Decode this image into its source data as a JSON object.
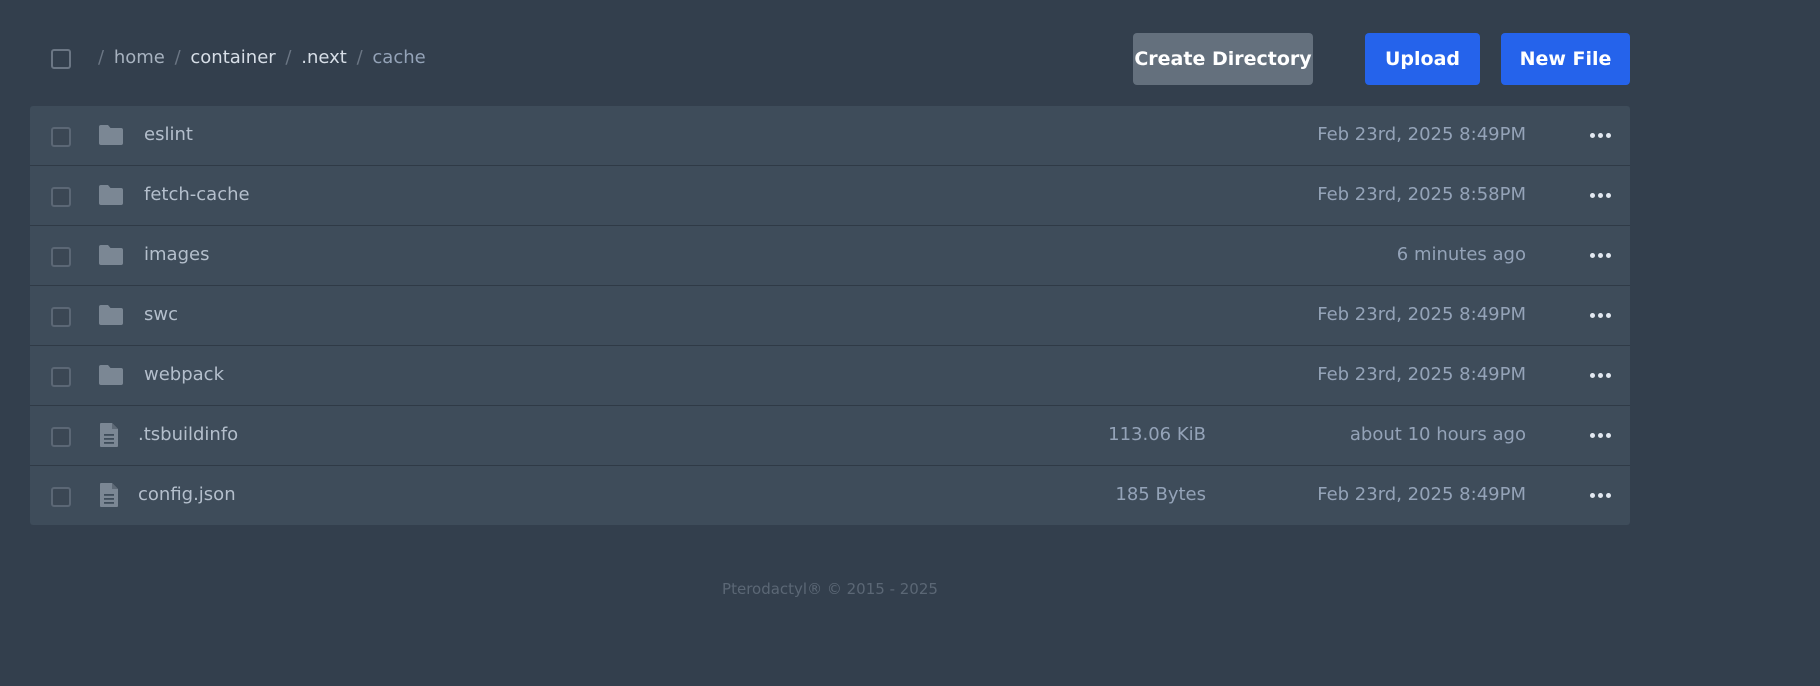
{
  "breadcrumb": {
    "segments": [
      {
        "label": "home"
      },
      {
        "label": "container"
      },
      {
        "label": ".next"
      },
      {
        "label": "cache"
      }
    ],
    "separator": "/"
  },
  "toolbar": {
    "create_directory_label": "Create Directory",
    "upload_label": "Upload",
    "new_file_label": "New File"
  },
  "files": [
    {
      "type": "directory",
      "name": "eslint",
      "size": "",
      "modified": "Feb 23rd, 2025 8:49PM"
    },
    {
      "type": "directory",
      "name": "fetch-cache",
      "size": "",
      "modified": "Feb 23rd, 2025 8:58PM"
    },
    {
      "type": "directory",
      "name": "images",
      "size": "",
      "modified": "6 minutes ago"
    },
    {
      "type": "directory",
      "name": "swc",
      "size": "",
      "modified": "Feb 23rd, 2025 8:49PM"
    },
    {
      "type": "directory",
      "name": "webpack",
      "size": "",
      "modified": "Feb 23rd, 2025 8:49PM"
    },
    {
      "type": "file",
      "name": ".tsbuildinfo",
      "size": "113.06 KiB",
      "modified": "about 10 hours ago"
    },
    {
      "type": "file",
      "name": "config.json",
      "size": "185 Bytes",
      "modified": "Feb 23rd, 2025 8:49PM"
    }
  ],
  "icons": {
    "directory": "folder-icon",
    "file": "file-text-icon",
    "menu": "more-horizontal-icon"
  },
  "colors": {
    "background": "#333f4d",
    "row": "#3e4c5a",
    "primary": "#2563eb",
    "secondary": "#64707d"
  },
  "footer": {
    "text": "Pterodactyl® © 2015 - 2025"
  }
}
